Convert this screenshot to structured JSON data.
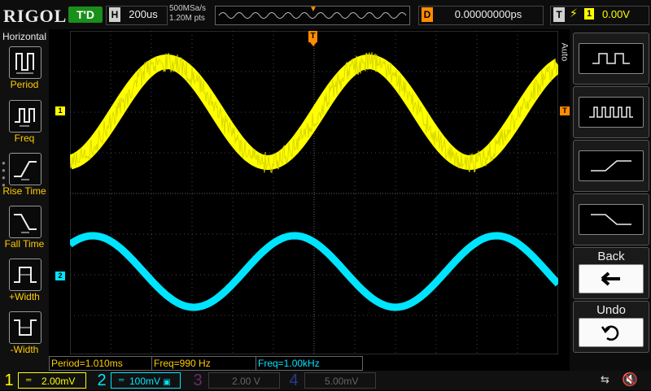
{
  "header": {
    "brand": "RIGOL",
    "run_status": "T'D",
    "horizontal_label": "H",
    "timebase": "200us",
    "sample_rate": "500MSa/s",
    "memory_depth": "1.20M pts",
    "delay_label": "D",
    "delay_value": "0.00000000ps",
    "trigger_label": "T",
    "trigger_channel": "1",
    "trigger_level": "0.00V"
  },
  "left_menu": {
    "title": "Horizontal",
    "items": [
      {
        "label": "Period",
        "icon": "period-icon"
      },
      {
        "label": "Freq",
        "icon": "frequency-icon"
      },
      {
        "label": "Rise Time",
        "icon": "rise-time-icon"
      },
      {
        "label": "Fall Time",
        "icon": "fall-time-icon"
      },
      {
        "label": "+Width",
        "icon": "positive-width-icon"
      },
      {
        "label": "-Width",
        "icon": "negative-width-icon"
      }
    ]
  },
  "right_menu": {
    "tab_label": "Auto",
    "buttons": [
      {
        "icon": "square-wave-icon"
      },
      {
        "icon": "pulse-train-icon"
      },
      {
        "icon": "rising-edge-icon"
      },
      {
        "icon": "falling-edge-icon"
      },
      {
        "label": "Back",
        "icon": "back-arrow-icon"
      },
      {
        "label": "Undo",
        "icon": "undo-icon"
      }
    ]
  },
  "markers": {
    "trigger_position": "T",
    "ch1": "1",
    "ch2": "2",
    "trigger_level": "T"
  },
  "measurements": [
    {
      "text": "Period=1.010ms"
    },
    {
      "text": "Freq=990 Hz"
    },
    {
      "text": "Freq=1.00kHz"
    }
  ],
  "channels": [
    {
      "num": "1",
      "scale": "2.00mV",
      "color": "#ffff00",
      "active": true
    },
    {
      "num": "2",
      "scale": "100mV",
      "color": "#00e5ff",
      "active": true
    },
    {
      "num": "3",
      "scale": "2.00 V",
      "color": "#c040c0",
      "active": false
    },
    {
      "num": "4",
      "scale": "5.00mV",
      "color": "#3a6aff",
      "active": false
    }
  ],
  "colors": {
    "ch1": "#ffff00",
    "ch2": "#00e5ff",
    "trigger": "#ff8c00",
    "measure_text": "#ffcc00"
  },
  "status": {
    "usb_icon": "usb-icon",
    "speaker_icon": "speaker-muted-icon"
  }
}
